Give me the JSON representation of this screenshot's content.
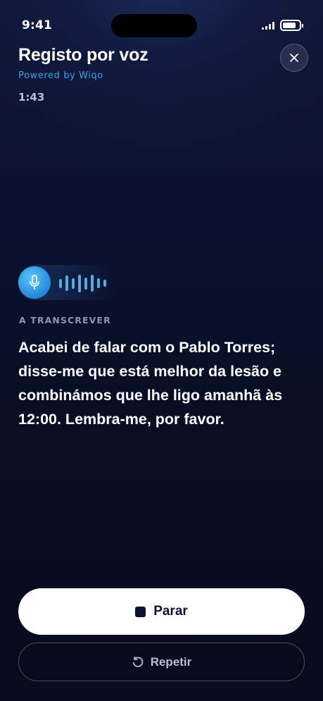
{
  "status_bar": {
    "time": "9:41"
  },
  "header": {
    "title": "Registo por voz",
    "powered_by": "Powered by Wiqo",
    "timer": "1:43",
    "close_icon": "close-icon"
  },
  "recorder": {
    "mic_icon": "microphone-icon",
    "waveform_levels": [
      0.45,
      0.8,
      0.55,
      0.9,
      0.6,
      0.85,
      0.5,
      0.35
    ],
    "status_label": "A TRANSCREVER",
    "transcript": "Acabei de falar com o Pablo Torres; disse-me que está melhor da lesão e combinámos que lhe ligo amanhã às 12:00. Lembra-me, por favor."
  },
  "actions": {
    "stop_label": "Parar",
    "stop_icon": "stop-icon",
    "repeat_label": "Repetir",
    "repeat_icon": "refresh-icon"
  },
  "colors": {
    "accent": "#3ba3e6",
    "background": "#0b1230",
    "primary_button": "#ffffff"
  }
}
